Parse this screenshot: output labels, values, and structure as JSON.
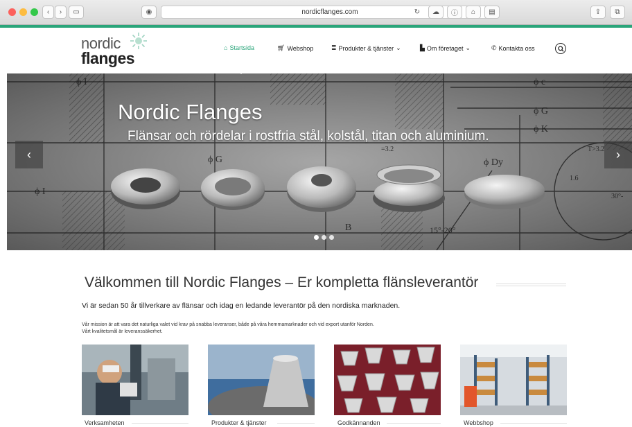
{
  "browser": {
    "url": "nordicflanges.com"
  },
  "site": {
    "logo_top": "nordic",
    "logo_bottom": "flanges"
  },
  "nav": {
    "items": [
      {
        "label": "Startsida"
      },
      {
        "label": "Webshop"
      },
      {
        "label": "Produkter & tjänster"
      },
      {
        "label": "Om företaget"
      },
      {
        "label": "Kontakta oss"
      }
    ]
  },
  "hero": {
    "title": "Nordic Flanges",
    "subtitle": "Flänsar och rördelar i rostfria stål, kolstål, titan och aluminium.",
    "drawing_labels": [
      "ϕ I",
      "ϕ c",
      "ϕ G",
      "ϕ K",
      "T>3.2",
      "=3.2",
      "ϕ G",
      "ϕ Dy",
      "1.6",
      "30°-",
      "15°-20°",
      "B",
      "ϕ I"
    ]
  },
  "content": {
    "heading": "Välkommen till Nordic Flanges – Er kompletta flänsleverantör",
    "intro": "Vi är sedan 50 år tillverkare av flänsar och idag en ledande leverantör på den nordiska marknaden.",
    "mission_line1": "Vår mission är att vara det naturliga valet vid krav på snabba leveranser, både på våra hemmamarknader och vid export utanför Norden.",
    "mission_line2": "Vårt kvalitetsmål är leveranssäkerhet."
  },
  "cards": [
    {
      "label": "Verksamheten"
    },
    {
      "label": "Produkter & tjänster"
    },
    {
      "label": "Godkännanden"
    },
    {
      "label": "Webbshop"
    }
  ],
  "colors": {
    "accent": "#2aa57a"
  }
}
